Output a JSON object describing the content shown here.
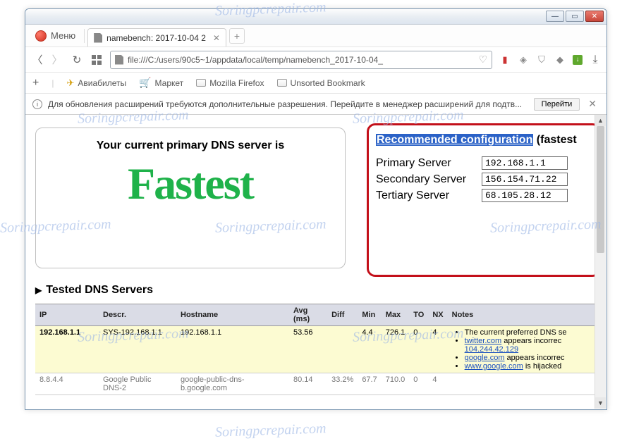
{
  "window": {
    "title": "namebench: 2017-10-04 2"
  },
  "menu_label": "Меню",
  "tab": {
    "title": "namebench: 2017-10-04 2"
  },
  "url": "file:///C:/users/90c5~1/appdata/local/temp/namebench_2017-10-04_",
  "bookmarks": {
    "aviabilety": "Авиабилеты",
    "market": "Маркет",
    "mozilla": "Mozilla Firefox",
    "unsorted": "Unsorted Bookmark"
  },
  "notification": {
    "message": "Для обновления расширений требуются дополнительные разрешения. Перейдите в менеджер расширений для подтв...",
    "button": "Перейти"
  },
  "primary": {
    "heading": "Your current primary DNS server is",
    "status": "Fastest"
  },
  "recommended": {
    "title_hl": "Recommended configuration",
    "title_suffix": " (fastest",
    "rows": [
      {
        "label": "Primary Server",
        "value": "192.168.1.1"
      },
      {
        "label": "Secondary Server",
        "value": "156.154.71.22"
      },
      {
        "label": "Tertiary Server",
        "value": "68.105.28.12"
      }
    ]
  },
  "tested_heading": "Tested DNS Servers",
  "table": {
    "headers": {
      "ip": "IP",
      "descr": "Descr.",
      "host": "Hostname",
      "avg": "Avg (ms)",
      "diff": "Diff",
      "min": "Min",
      "max": "Max",
      "to": "TO",
      "nx": "NX",
      "notes": "Notes"
    },
    "rows": [
      {
        "ip": "192.168.1.1",
        "descr": "SYS-192.168.1.1",
        "host": "192.168.1.1",
        "avg": "53.56",
        "diff": "",
        "min": "4.4",
        "max": "726.1",
        "to": "0",
        "nx": "4",
        "notes": {
          "n1": "The current preferred DNS se",
          "n2a": "twitter.com",
          "n2b": " appears incorrec",
          "n2c": "104.244.42.129",
          "n3a": "google.com",
          "n3b": " appears incorrec",
          "n4a": "www.google.com",
          "n4b": " is hijacked"
        }
      },
      {
        "ip": "8.8.4.4",
        "descr": "Google Public DNS-2",
        "host": "google-public-dns-b.google.com",
        "avg": "80.14",
        "diff": "33.2%",
        "min": "67.7",
        "max": "710.0",
        "to": "0",
        "nx": "4"
      }
    ]
  },
  "watermark": "Soringpcrepair.com"
}
